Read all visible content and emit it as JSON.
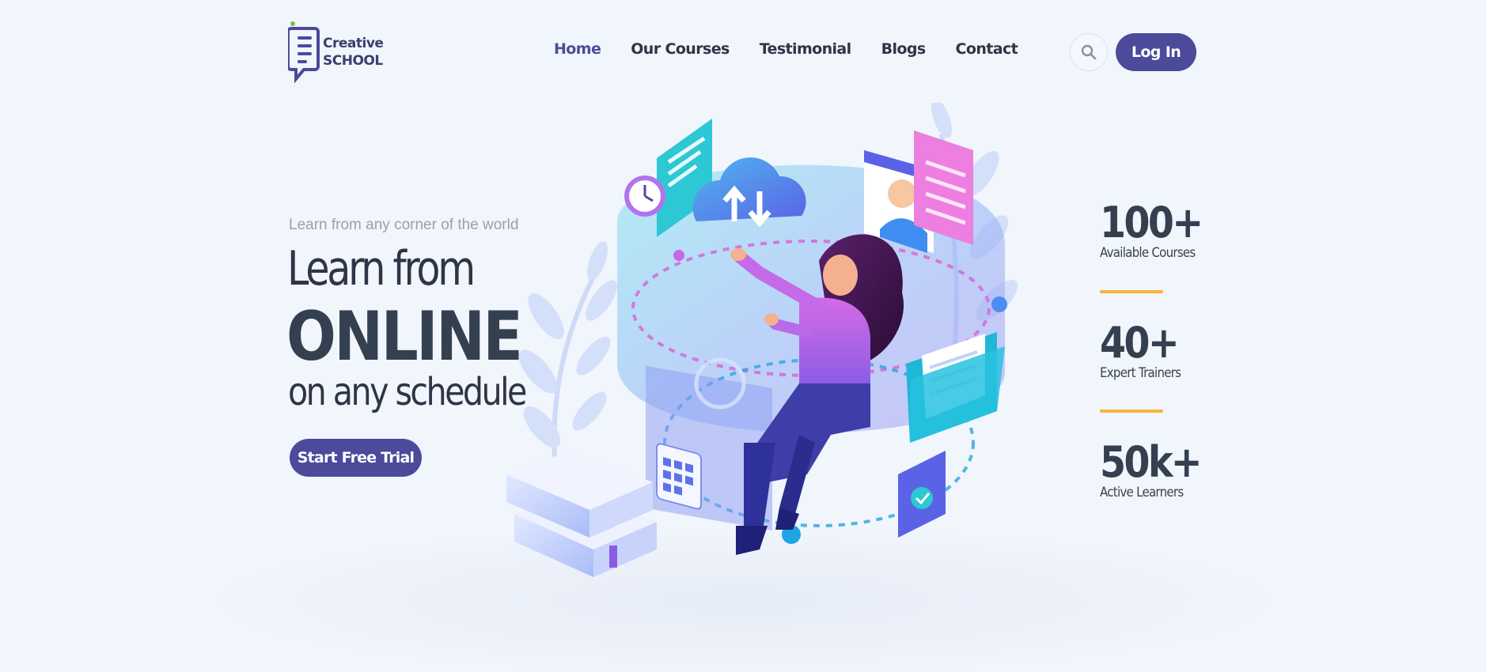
{
  "brand": {
    "line1": "Creative",
    "line2": "SCHOOL",
    "logo_icon": "speech-bubble-book-icon"
  },
  "nav": {
    "items": [
      {
        "label": "Home",
        "active": true
      },
      {
        "label": "Our Courses",
        "active": false
      },
      {
        "label": "Testimonial",
        "active": false
      },
      {
        "label": "Blogs",
        "active": false
      },
      {
        "label": "Contact",
        "active": false
      }
    ]
  },
  "header": {
    "search_icon": "search-icon",
    "login_label": "Log In"
  },
  "hero": {
    "tagline": "Learn from any corner of the world",
    "line1": "Learn from",
    "line2": "ONLINE",
    "line3": "on any schedule",
    "cta_label": "Start Free Trial"
  },
  "stats": [
    {
      "value": "100+",
      "label": "Available Courses"
    },
    {
      "value": "40+",
      "label": "Expert Trainers"
    },
    {
      "value": "50k+",
      "label": "Active Learners"
    }
  ],
  "colors": {
    "primary": "#4b4a9b",
    "accent": "#f6b33b",
    "heading": "#34404f",
    "background": "#f1f5fc"
  }
}
